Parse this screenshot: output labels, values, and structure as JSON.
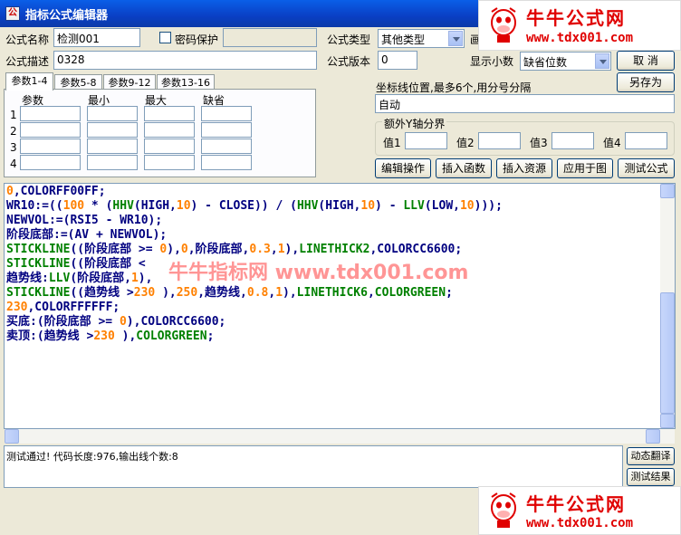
{
  "window": {
    "title": "指标公式编辑器"
  },
  "form": {
    "name_label": "公式名称",
    "name_value": "检测001",
    "password_label": "密码保护",
    "type_label": "公式类型",
    "type_value": "其他类型",
    "draw_label": "画",
    "desc_label": "公式描述",
    "desc_value": "0328",
    "version_label": "公式版本",
    "version_value": "0",
    "decimal_label": "显示小数",
    "decimal_value": "缺省位数",
    "cancel_button": "取  消",
    "saveas_button": "另存为"
  },
  "tabs": [
    "参数1-4",
    "参数5-8",
    "参数9-12",
    "参数13-16"
  ],
  "param_table": {
    "headers": [
      "参数",
      "最小",
      "最大",
      "缺省"
    ],
    "rows": [
      "1",
      "2",
      "3",
      "4"
    ]
  },
  "axis": {
    "label": "坐标线位置,最多6个,用分号分隔",
    "value": "自动",
    "extra_group": "额外Y轴分界",
    "values": [
      "值1",
      "值2",
      "值3",
      "值4"
    ]
  },
  "actions": [
    "编辑操作",
    "插入函数",
    "插入资源",
    "应用于图",
    "测试公式"
  ],
  "code": [
    [
      {
        "t": "0",
        "c": "c-orange"
      },
      {
        "t": ",COLORFF00FF;",
        "c": "c-black"
      }
    ],
    [
      {
        "t": "WR10:=((",
        "c": "c-black"
      },
      {
        "t": "100",
        "c": "c-orange"
      },
      {
        "t": " * (",
        "c": "c-black"
      },
      {
        "t": "HHV",
        "c": "c-green"
      },
      {
        "t": "(HIGH,",
        "c": "c-black"
      },
      {
        "t": "10",
        "c": "c-orange"
      },
      {
        "t": ") - CLOSE)) / (",
        "c": "c-black"
      },
      {
        "t": "HHV",
        "c": "c-green"
      },
      {
        "t": "(HIGH,",
        "c": "c-black"
      },
      {
        "t": "10",
        "c": "c-orange"
      },
      {
        "t": ") - ",
        "c": "c-black"
      },
      {
        "t": "LLV",
        "c": "c-green"
      },
      {
        "t": "(LOW,",
        "c": "c-black"
      },
      {
        "t": "10",
        "c": "c-orange"
      },
      {
        "t": ")));",
        "c": "c-black"
      }
    ],
    [
      {
        "t": "NEWVOL:=(RSI5 - WR10);",
        "c": "c-black"
      }
    ],
    [
      {
        "t": "阶段底部:=(AV + NEWVOL);",
        "c": "c-black"
      }
    ],
    [
      {
        "t": "STICKLINE",
        "c": "c-green"
      },
      {
        "t": "((阶段底部 >= ",
        "c": "c-black"
      },
      {
        "t": "0",
        "c": "c-orange"
      },
      {
        "t": "),",
        "c": "c-black"
      },
      {
        "t": "0",
        "c": "c-orange"
      },
      {
        "t": ",阶段底部,",
        "c": "c-black"
      },
      {
        "t": "0.3",
        "c": "c-orange"
      },
      {
        "t": ",",
        "c": "c-black"
      },
      {
        "t": "1",
        "c": "c-orange"
      },
      {
        "t": "),",
        "c": "c-black"
      },
      {
        "t": "LINETHICK2",
        "c": "c-green"
      },
      {
        "t": ",COLORCC6600;",
        "c": "c-black"
      }
    ],
    [
      {
        "t": "STICKLINE",
        "c": "c-green"
      },
      {
        "t": "((阶段底部 < ",
        "c": "c-black"
      }
    ],
    [
      {
        "t": "趋势线:",
        "c": "c-black"
      },
      {
        "t": "LLV",
        "c": "c-green"
      },
      {
        "t": "(阶段底部,",
        "c": "c-black"
      },
      {
        "t": "1",
        "c": "c-orange"
      },
      {
        "t": "),",
        "c": "c-black"
      }
    ],
    [
      {
        "t": "STICKLINE",
        "c": "c-green"
      },
      {
        "t": "((趋势线 >",
        "c": "c-black"
      },
      {
        "t": "230",
        "c": "c-orange"
      },
      {
        "t": " ),",
        "c": "c-black"
      },
      {
        "t": "250",
        "c": "c-orange"
      },
      {
        "t": ",趋势线,",
        "c": "c-black"
      },
      {
        "t": "0.8",
        "c": "c-orange"
      },
      {
        "t": ",",
        "c": "c-black"
      },
      {
        "t": "1",
        "c": "c-orange"
      },
      {
        "t": "),",
        "c": "c-black"
      },
      {
        "t": "LINETHICK6",
        "c": "c-green"
      },
      {
        "t": ",",
        "c": "c-black"
      },
      {
        "t": "COLORGREEN",
        "c": "c-green"
      },
      {
        "t": ";",
        "c": "c-black"
      }
    ],
    [
      {
        "t": "230",
        "c": "c-orange"
      },
      {
        "t": ",COLORFFFFFF;",
        "c": "c-black"
      }
    ],
    [
      {
        "t": "买底:(阶段底部 >= ",
        "c": "c-black"
      },
      {
        "t": "0",
        "c": "c-orange"
      },
      {
        "t": "),COLORCC6600;",
        "c": "c-black"
      }
    ],
    [
      {
        "t": "卖顶:(趋势线 >",
        "c": "c-black"
      },
      {
        "t": "230",
        "c": "c-orange"
      },
      {
        "t": " ),",
        "c": "c-black"
      },
      {
        "t": "COLORGREEN",
        "c": "c-green"
      },
      {
        "t": ";",
        "c": "c-black"
      }
    ]
  ],
  "status": {
    "message": "测试通过! 代码长度:976,输出线个数:8"
  },
  "side_buttons": [
    "动态翻译",
    "测试结果"
  ],
  "watermark": {
    "title": "牛牛公式网",
    "url": "www.tdx001.com",
    "overlay": "牛牛指标网  www.tdx001.com"
  }
}
